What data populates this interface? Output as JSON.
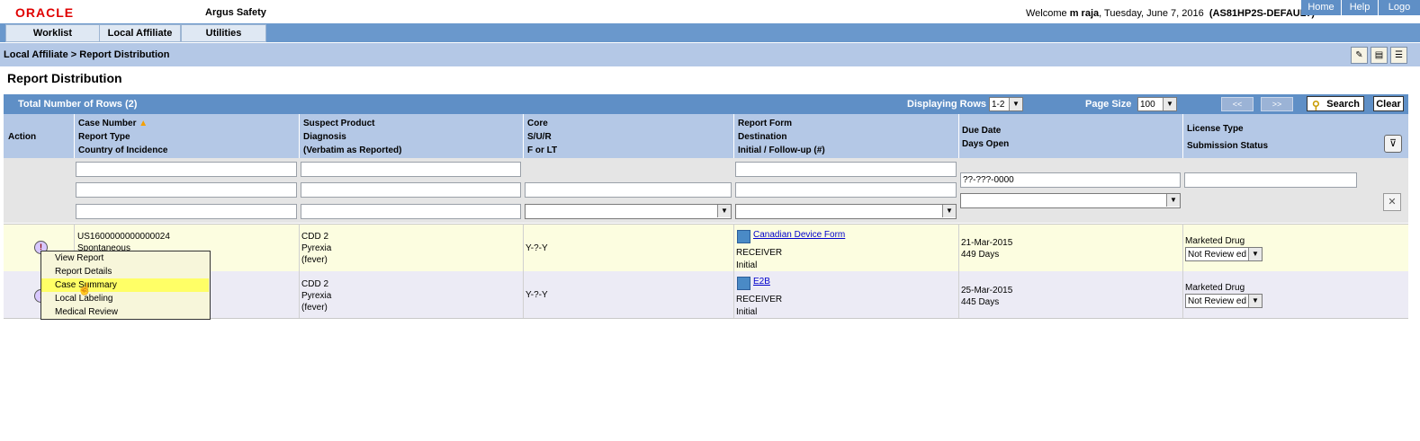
{
  "header": {
    "logo": "ORACLE",
    "app_name": "Argus Safety",
    "welcome_prefix": "Welcome",
    "user": "m raja",
    "date": ", Tuesday, June 7, 2016",
    "profile": "(AS81HP2S-DEFAULT)",
    "links": [
      "Home",
      "Help",
      "Logo"
    ]
  },
  "menu": [
    "Worklist",
    "Local Affiliate",
    "Utilities"
  ],
  "breadcrumb": "Local Affiliate > Report Distribution",
  "page_title": "Report Distribution",
  "grid": {
    "total_rows_label": "Total Number of Rows (2)",
    "displaying_rows_label": "Displaying Rows",
    "displaying_rows_value": "1-2",
    "page_size_label": "Page Size",
    "page_size_value": "100",
    "prev_label": "<<",
    "next_label": ">>",
    "search_label": "Search",
    "clear_label": "Clear"
  },
  "columns": {
    "action": "Action",
    "case": [
      "Case Number",
      "Report Type",
      "Country of Incidence"
    ],
    "product": [
      "Suspect Product",
      "Diagnosis",
      "(Verbatim as Reported)"
    ],
    "core": [
      "Core",
      "S/U/R",
      "F or LT"
    ],
    "report": [
      "Report Form",
      "Destination",
      "Initial / Follow-up (#)"
    ],
    "due": [
      "Due Date",
      "Days Open"
    ],
    "license": [
      "License Type",
      "Submission Status"
    ]
  },
  "filters": {
    "due_date_value": "??-???-0000"
  },
  "rows": [
    {
      "case_number": "US1600000000000024",
      "report_type": "Spontaneous",
      "product": "CDD 2",
      "diagnosis": "Pyrexia",
      "verbatim": "(fever)",
      "core": "Y-?-Y",
      "report_form": "Canadian Device Form",
      "destination": "RECEIVER",
      "initial": "Initial",
      "due_date": "21-Mar-2015",
      "days_open": "449 Days",
      "license_type": "Marketed Drug",
      "submission_status": "Not Review ed"
    },
    {
      "case_number": "",
      "report_type": "",
      "product": "CDD 2",
      "diagnosis": "Pyrexia",
      "verbatim": "(fever)",
      "core": "Y-?-Y",
      "report_form": "E2B",
      "destination": "RECEIVER",
      "initial": "Initial",
      "due_date": "25-Mar-2015",
      "days_open": "445 Days",
      "license_type": "Marketed Drug",
      "submission_status": "Not Review ed"
    }
  ],
  "context_menu": [
    "View Report",
    "Report Details",
    "Case Summary",
    "Local Labeling",
    "Medical Review"
  ],
  "colors": {
    "menu_bar": "#6a98cc",
    "breadcrumb_bar": "#b4c8e6",
    "row_highlight": "#fcfde0",
    "menu_highlight": "#ffff66"
  }
}
